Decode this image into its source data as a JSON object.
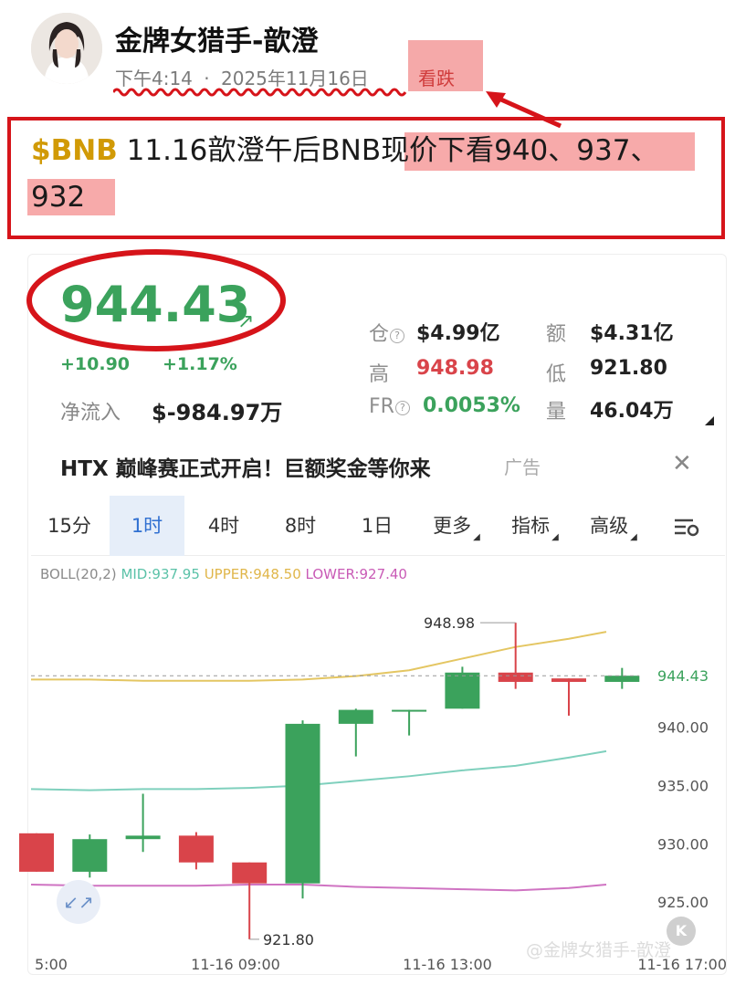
{
  "post": {
    "author": "金牌女猎手-歆澄",
    "time": "下午4:14",
    "separator": "·",
    "date": "2025年11月16日",
    "sentiment": "看跌",
    "content_tag": "$BNB",
    "content_main": " 11.16歆澄午后BNB",
    "content_highlight": "现价下看940、937、",
    "content_line2": "932"
  },
  "ticker": {
    "price": "944.43",
    "change": "+10.90",
    "change_pct": "+1.17%",
    "netflow_label": "净流入",
    "netflow_value": "$-984.97万",
    "stats": {
      "oi_label": "仓",
      "oi_value": "$4.99亿",
      "volume_label": "额",
      "volume_value": "$4.31亿",
      "high_label": "高",
      "high_value": "948.98",
      "low_label": "低",
      "low_value": "921.80",
      "fr_label": "FR",
      "fr_value": "0.0053%",
      "qty_label": "量",
      "qty_value": "46.04万"
    },
    "colors": {
      "up": "#3ba25c",
      "down": "#d9444a",
      "accent": "#2f6fd1"
    }
  },
  "ad": {
    "text": "HTX 巅峰赛正式开启！巨额奖金等你来",
    "tag": "广告",
    "close_icon": "close-icon"
  },
  "tabs": [
    {
      "label": "15分",
      "active": false
    },
    {
      "label": "1时",
      "active": true
    },
    {
      "label": "4时",
      "active": false
    },
    {
      "label": "8时",
      "active": false
    },
    {
      "label": "1日",
      "active": false
    },
    {
      "label": "更多",
      "active": false
    },
    {
      "label": "指标",
      "active": false
    },
    {
      "label": "高级",
      "active": false
    }
  ],
  "chart_data": {
    "type": "candlestick",
    "indicator": {
      "name": "BOLL(20,2)",
      "mid_label": "MID:937.95",
      "upper_label": "UPPER:948.50",
      "lower_label": "LOWER:927.40"
    },
    "current_price_label": "944.43",
    "ylim": [
      922.5,
      951.5
    ],
    "y_ticks": [
      "940.00",
      "935.00",
      "930.00",
      "925.00"
    ],
    "x_ticks": [
      "5:00",
      "11-16 09:00",
      "11-16 13:00",
      "11-16 17:00"
    ],
    "annotations": {
      "high": "948.98",
      "low": "921.80"
    },
    "candles": [
      {
        "open": 930.9,
        "high": 930.9,
        "low": 927.6,
        "close": 927.6
      },
      {
        "open": 927.6,
        "high": 930.8,
        "low": 927.1,
        "close": 930.4
      },
      {
        "open": 930.4,
        "high": 934.3,
        "low": 929.3,
        "close": 930.7
      },
      {
        "open": 930.7,
        "high": 931.0,
        "low": 927.8,
        "close": 928.4
      },
      {
        "open": 928.4,
        "high": 928.4,
        "low": 921.8,
        "close": 926.6
      },
      {
        "open": 926.6,
        "high": 940.6,
        "low": 925.3,
        "close": 940.3
      },
      {
        "open": 940.3,
        "high": 941.6,
        "low": 937.5,
        "close": 941.5
      },
      {
        "open": 941.5,
        "high": 941.5,
        "low": 939.3,
        "close": 941.5
      },
      {
        "open": 941.6,
        "high": 945.2,
        "low": 941.6,
        "close": 944.7
      },
      {
        "open": 944.7,
        "high": 948.98,
        "low": 943.3,
        "close": 943.9
      },
      {
        "open": 944.2,
        "high": 944.2,
        "low": 941.0,
        "close": 943.9
      },
      {
        "open": 943.9,
        "high": 945.1,
        "low": 943.3,
        "close": 944.43
      }
    ],
    "boll_upper": [
      944.1,
      944.1,
      944.0,
      944.0,
      944.0,
      944.1,
      944.4,
      944.9,
      945.9,
      946.9,
      947.6,
      948.2
    ],
    "boll_mid": [
      934.7,
      934.6,
      934.7,
      934.7,
      934.8,
      935.0,
      935.4,
      935.8,
      936.3,
      936.7,
      937.4,
      937.95
    ],
    "boll_lower": [
      926.5,
      926.4,
      926.4,
      926.4,
      926.5,
      926.5,
      926.3,
      926.2,
      926.1,
      926.0,
      926.2,
      926.5
    ],
    "watermark": "@金牌女猎手-歆澄"
  }
}
